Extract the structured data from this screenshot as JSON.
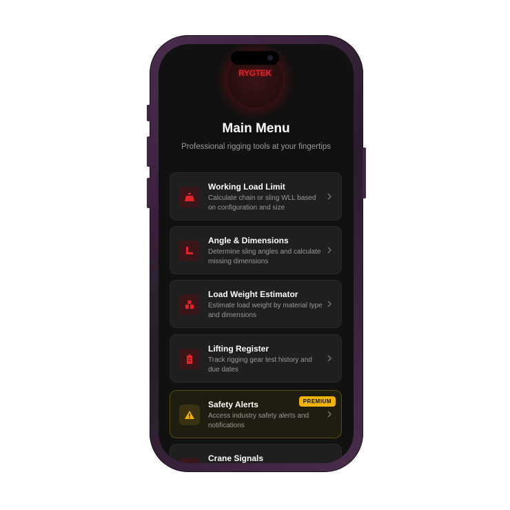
{
  "app": {
    "logo_text": "RYGTEK",
    "title": "Main Menu",
    "subtitle": "Professional rigging tools at your fingertips"
  },
  "menu": {
    "items": [
      {
        "title": "Working Load Limit",
        "description": "Calculate chain or sling WLL based on configuration and size",
        "icon": "weight-icon"
      },
      {
        "title": "Angle & Dimensions",
        "description": "Determine sling angles and calculate missing dimensions",
        "icon": "ruler-angle-icon"
      },
      {
        "title": "Load Weight Estimator",
        "description": "Estimate load weight by material type and dimensions",
        "icon": "boxes-icon"
      },
      {
        "title": "Lifting Register",
        "description": "Track rigging gear test history and due dates",
        "icon": "clipboard-icon"
      },
      {
        "title": "Safety Alerts",
        "description": "Access industry safety alerts and notifications",
        "icon": "warning-icon",
        "badge": "PREMIUM"
      },
      {
        "title": "Crane Signals",
        "description": "",
        "icon": "hand-signal-icon"
      }
    ]
  },
  "colors": {
    "accent": "#e2232c",
    "premium": "#f0b400",
    "background": "#111111",
    "card": "#1f1f20"
  }
}
